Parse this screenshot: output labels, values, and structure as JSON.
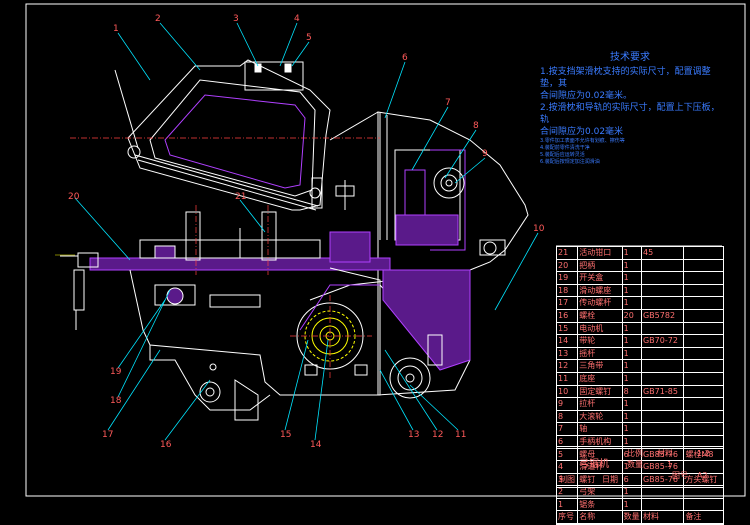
{
  "tech_title": "技术要求",
  "tech_lines": [
    "1.按支挡架滑枕支持的实际尺寸，配置调整垫，其",
    "  合间隙应为0.02毫米。",
    "2.按滑枕和导轨的实际尺寸，配置上下压板，轨",
    "  合间隙应为0.02毫米"
  ],
  "tech_small": [
    "3.零件加工表面不允许有划痕、擦伤等",
    "4.装配前零件清洗干净",
    "5.装配后应运转灵活",
    "6.装配后按规定加注润滑油"
  ],
  "callouts": [
    "1",
    "2",
    "3",
    "4",
    "5",
    "6",
    "7",
    "8",
    "9",
    "10",
    "11",
    "12",
    "13",
    "14",
    "15",
    "16",
    "17",
    "18",
    "19",
    "20",
    "21"
  ],
  "bom_rows": [
    [
      "21",
      "活动钳口",
      "1",
      "45",
      ""
    ],
    [
      "20",
      "把柄",
      "1",
      "",
      ""
    ],
    [
      "19",
      "开关盒",
      "1",
      "",
      ""
    ],
    [
      "18",
      "滑动螺座",
      "1",
      "",
      ""
    ],
    [
      "17",
      "传动螺杆",
      "1",
      "",
      ""
    ],
    [
      "16",
      "螺栓",
      "20",
      "GB5782",
      ""
    ],
    [
      "15",
      "电动机",
      "1",
      "",
      ""
    ],
    [
      "14",
      "带轮",
      "1",
      "GB70-72",
      ""
    ],
    [
      "13",
      "摇杆",
      "1",
      "",
      ""
    ],
    [
      "12",
      "三角带",
      "1",
      "",
      ""
    ],
    [
      "11",
      "底座",
      "1",
      "",
      ""
    ],
    [
      "10",
      "固定螺钉",
      "8",
      "GB71-85",
      ""
    ],
    [
      "9",
      "拉杆",
      "1",
      "",
      ""
    ],
    [
      "8",
      "大滚轮",
      "1",
      "",
      ""
    ],
    [
      "7",
      "轴",
      "1",
      "",
      ""
    ],
    [
      "6",
      "手柄机构",
      "1",
      "",
      ""
    ],
    [
      "5",
      "螺母",
      "6",
      "GB85-76",
      "螺栓M8"
    ],
    [
      "4",
      "滑道杆",
      "1",
      "GB85-76",
      ""
    ],
    [
      "3",
      "螺钉",
      "6",
      "GB85-76",
      "方头螺钉"
    ],
    [
      "2",
      "弓架",
      "1",
      "",
      ""
    ],
    [
      "1",
      "锯条",
      "1",
      "",
      ""
    ]
  ],
  "bom_header": [
    "序号",
    "名称",
    "数量",
    "材料",
    "备注"
  ],
  "title_block": {
    "name": "弓锯机",
    "ratio_label": "比例",
    "ratio": "1:2",
    "qty_label": "数量",
    "qty": "1",
    "sheet_label": "图号",
    "sheet": "A2",
    "drawer": "制图",
    "checker": "审核",
    "date": "日期",
    "mat_label": "材料"
  },
  "colors": {
    "outline": "#ffffff",
    "hatch": "#b040ff",
    "leader": "#00e5ff",
    "dim": "#ffff00",
    "text_red": "#ff5a5a",
    "note_blue": "#3a7bff",
    "green": "#40ff40",
    "frame": "#ffffff"
  }
}
